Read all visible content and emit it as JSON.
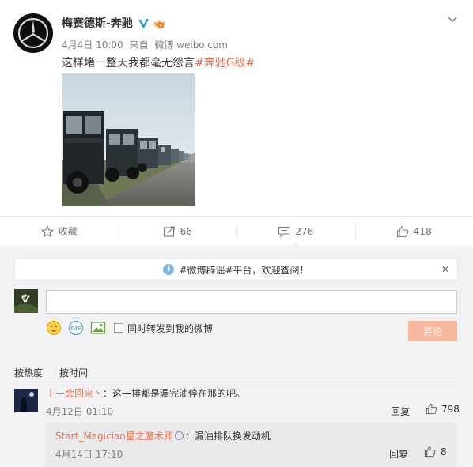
{
  "post": {
    "author": "梅赛德斯-奔驰",
    "date": "4月4日 10:00",
    "source_prefix": "来自",
    "source": "微博 weibo.com",
    "text": "这样堵一整天我都毫无怨言",
    "hashtag": "#奔驰G级#"
  },
  "actions": {
    "favorite": "收藏",
    "repost": "66",
    "comment": "276",
    "like": "418"
  },
  "notice": {
    "text": "#微博辟谣#平台，欢迎查阅！"
  },
  "composer": {
    "input_value": "",
    "forward_label": "同时转发到我的微博",
    "submit_label": "评论"
  },
  "sort": {
    "hot": "按热度",
    "time": "按时间"
  },
  "comments": [
    {
      "user": "丨一会回来丶",
      "text": "：这一排都是漏完油停在那的吧。",
      "time": "4月12日 01:10",
      "reply": "回复",
      "likes": "798",
      "replies": [
        {
          "user": "Start_Magician星之魔术师",
          "text": "：漏油排队换发动机",
          "time": "4月14日 17:10",
          "reply": "回复",
          "likes": "8"
        }
      ]
    }
  ],
  "colors": {
    "accent": "#eb7350",
    "verified": "#2f9bde",
    "comment_bg": "#f2f2f5",
    "submit_disabled": "#f7b89e"
  }
}
